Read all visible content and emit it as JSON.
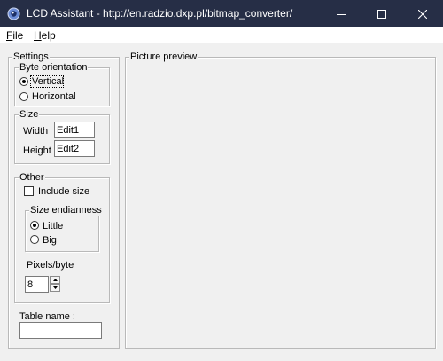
{
  "window": {
    "title": "LCD Assistant -  http://en.radzio.dxp.pl/bitmap_converter/",
    "titlebar_color": "#262e46"
  },
  "menu": {
    "items": [
      {
        "accel": "F",
        "rest": "ile"
      },
      {
        "accel": "H",
        "rest": "elp"
      }
    ]
  },
  "settings": {
    "label": "Settings",
    "byte_orientation": {
      "label": "Byte orientation",
      "vertical": "Vertical",
      "horizontal": "Horizontal",
      "selected": "Vertical"
    },
    "size": {
      "label": "Size",
      "width_label": "Width",
      "width_value": "Edit1",
      "height_label": "Height",
      "height_value": "Edit2"
    },
    "other": {
      "label": "Other",
      "include_size": "Include size",
      "include_size_checked": false,
      "endianness": {
        "label": "Size endianness",
        "little": "Little",
        "big": "Big",
        "selected": "Little"
      },
      "pixels_label": "Pixels/byte",
      "pixels_value": "8"
    },
    "table_name_label": "Table name :",
    "table_name_value": ""
  },
  "preview": {
    "label": "Picture preview"
  }
}
